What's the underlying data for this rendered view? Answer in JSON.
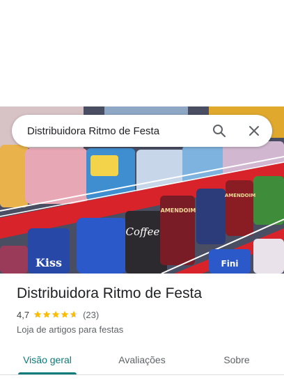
{
  "search": {
    "query": "Distribuidora Ritmo de Festa"
  },
  "place": {
    "name": "Distribuidora Ritmo de Festa",
    "rating": "4,7",
    "rating_stars": 4.7,
    "reviews_count": "(23)",
    "category": "Loja de artigos para festas"
  },
  "photo": {
    "package_labels": [
      "Kiss",
      "Coffee",
      "AMENDOIM",
      "AMENDOIM",
      "Fini"
    ]
  },
  "tabs": [
    {
      "label": "Visão geral",
      "active": true
    },
    {
      "label": "Avaliações",
      "active": false
    },
    {
      "label": "Sobre",
      "active": false
    }
  ],
  "colors": {
    "accent": "#0b7a78",
    "star": "#fbbc04",
    "shelf": "#d8232a"
  }
}
